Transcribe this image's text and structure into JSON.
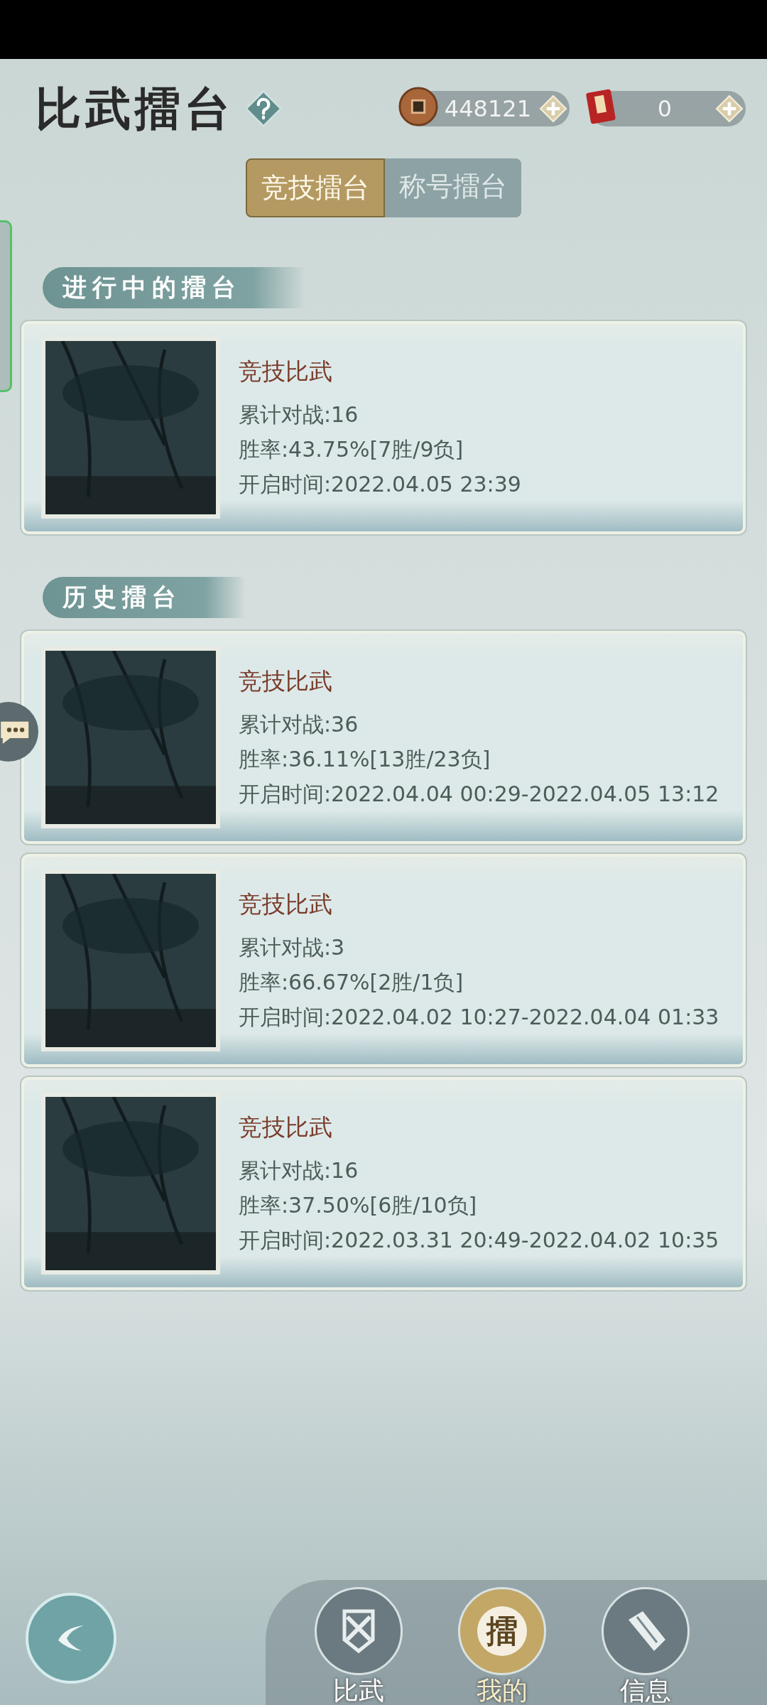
{
  "header": {
    "title": "比武擂台",
    "coins": "448121",
    "tickets": "0"
  },
  "tabs": [
    {
      "label": "竞技擂台",
      "selected": true
    },
    {
      "label": "称号擂台",
      "selected": false
    }
  ],
  "sections": [
    {
      "title": "进行中的擂台",
      "cards": [
        {
          "title": "竞技比武",
          "battles": "累计对战:16",
          "win_rate": "胜率:43.75%[7胜/9负]",
          "time": "开启时间:2022.04.05 23:39"
        }
      ]
    },
    {
      "title": "历史擂台",
      "cards": [
        {
          "title": "竞技比武",
          "battles": "累计对战:36",
          "win_rate": "胜率:36.11%[13胜/23负]",
          "time": "开启时间:2022.04.04 00:29-2022.04.05 13:12"
        },
        {
          "title": "竞技比武",
          "battles": "累计对战:3",
          "win_rate": "胜率:66.67%[2胜/1负]",
          "time": "开启时间:2022.04.02 10:27-2022.04.04 01:33"
        },
        {
          "title": "竞技比武",
          "battles": "累计对战:16",
          "win_rate": "胜率:37.50%[6胜/10负]",
          "time": "开启时间:2022.03.31 20:49-2022.04.02 10:35"
        }
      ]
    }
  ],
  "nav": [
    {
      "kind": "duel",
      "label": "比武",
      "selected": false
    },
    {
      "kind": "mine",
      "glyph": "擂",
      "label": "我的",
      "selected": true
    },
    {
      "kind": "info",
      "label": "信息",
      "selected": false
    }
  ]
}
